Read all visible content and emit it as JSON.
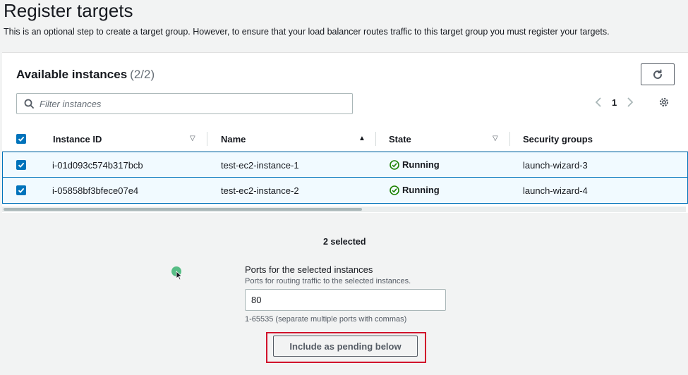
{
  "header": {
    "title": "Register targets",
    "description": "This is an optional step to create a target group. However, to ensure that your load balancer routes traffic to this target group you must register your targets."
  },
  "instances_panel": {
    "heading": "Available instances",
    "count": "(2/2)",
    "filter_placeholder": "Filter instances",
    "page_number": "1",
    "columns": [
      "Instance ID",
      "Name",
      "State",
      "Security groups"
    ],
    "rows": [
      {
        "instance_id": "i-01d093c574b317bcb",
        "name": "test-ec2-instance-1",
        "state": "Running",
        "security_group": "launch-wizard-3"
      },
      {
        "instance_id": "i-05858bf3bfece07e4",
        "name": "test-ec2-instance-2",
        "state": "Running",
        "security_group": "launch-wizard-4"
      }
    ]
  },
  "selection": {
    "selected_text": "2 selected",
    "ports_label": "Ports for the selected instances",
    "ports_description": "Ports for routing traffic to the selected instances.",
    "ports_value": "80",
    "ports_hint": "1-65535 (separate multiple ports with commas)",
    "include_button": "Include as pending below"
  },
  "colors": {
    "accent": "#0073bb",
    "running": "#1d8102",
    "highlight": "#d1122b"
  }
}
